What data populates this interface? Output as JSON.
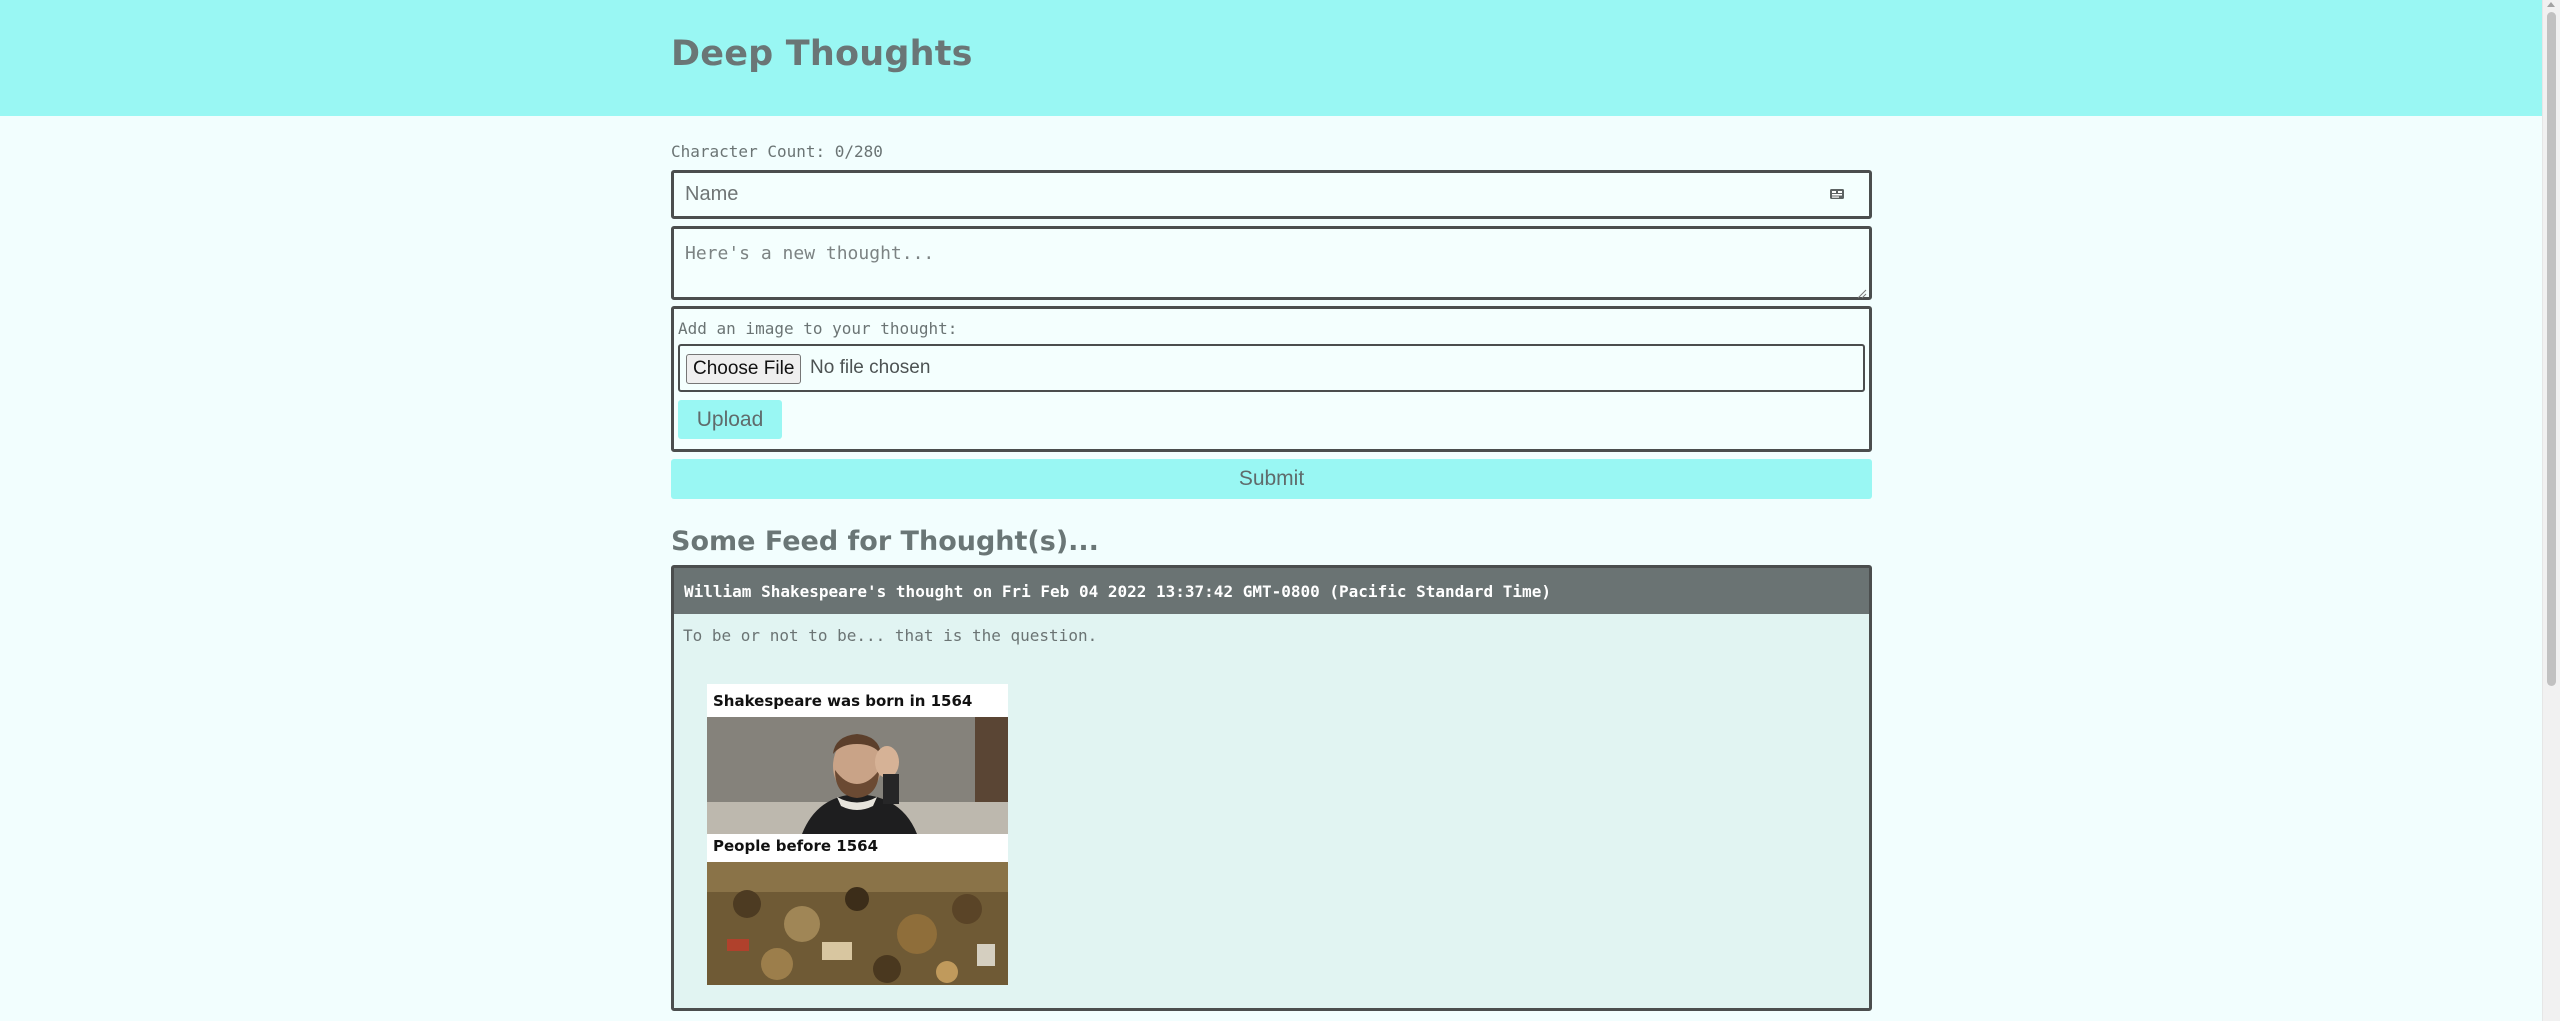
{
  "header": {
    "title": "Deep Thoughts"
  },
  "form": {
    "character_count": "Character Count: 0/280",
    "name_placeholder": "Name",
    "name_value": "",
    "thought_placeholder": "Here's a new thought...",
    "thought_value": "",
    "image_label": "Add an image to your thought:",
    "choose_file_label": "Choose File",
    "no_file_text": "No file chosen",
    "upload_label": "Upload",
    "submit_label": "Submit"
  },
  "feed": {
    "title": "Some Feed for Thought(s)...",
    "thoughts": [
      {
        "header": "William Shakespeare's thought on Fri Feb 04 2022 13:37:42 GMT-0800 (Pacific Standard Time)",
        "text": "To be or not to be... that is the question.",
        "image": {
          "top_caption": "Shakespeare was born in 1564",
          "bottom_caption": "People before 1564"
        }
      }
    ]
  },
  "colors": {
    "accent": "#99f7f3",
    "background": "#f2fefe",
    "card_header": "#6a7373",
    "card_body": "#e1f4f2",
    "border": "#4b4e4e"
  }
}
